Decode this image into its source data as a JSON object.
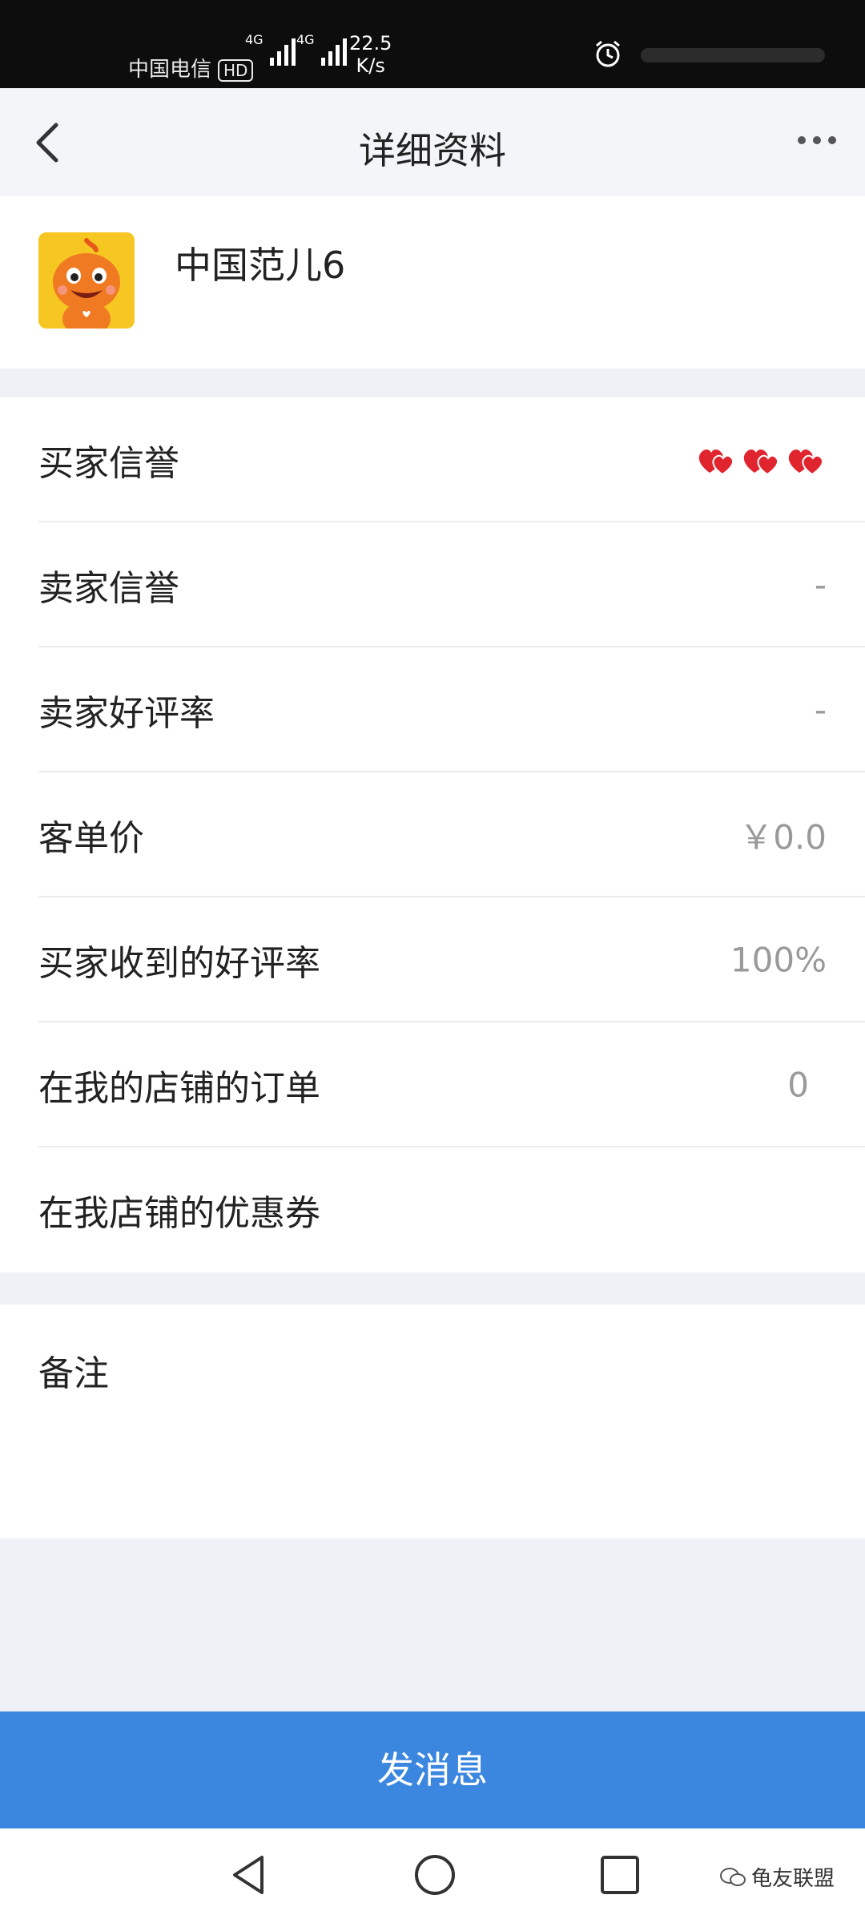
{
  "status_bar": {
    "carrier": "中国电信",
    "hd": "HD",
    "network_1": "4G",
    "network_2": "4G",
    "speed_value": "22.5",
    "speed_unit": "K/s"
  },
  "navbar": {
    "title": "详细资料"
  },
  "profile": {
    "name": "中国范儿6"
  },
  "details": {
    "rows": [
      {
        "label": "买家信誉",
        "value": "",
        "hearts": 3
      },
      {
        "label": "卖家信誉",
        "value": "-"
      },
      {
        "label": "卖家好评率",
        "value": "-"
      },
      {
        "label": "客单价",
        "value": "￥0.0"
      },
      {
        "label": "买家收到的好评率",
        "value": "100%"
      },
      {
        "label": "在我的店铺的订单",
        "value": "0"
      },
      {
        "label": "在我店铺的优惠券",
        "value": ""
      }
    ]
  },
  "notes": {
    "label": "备注"
  },
  "send_button": {
    "label": "发消息"
  },
  "watermark": {
    "text": "龟友联盟"
  },
  "colors": {
    "accent": "#3b86df",
    "heart": "#e0252e",
    "avatar_bg": "#f6c623"
  }
}
